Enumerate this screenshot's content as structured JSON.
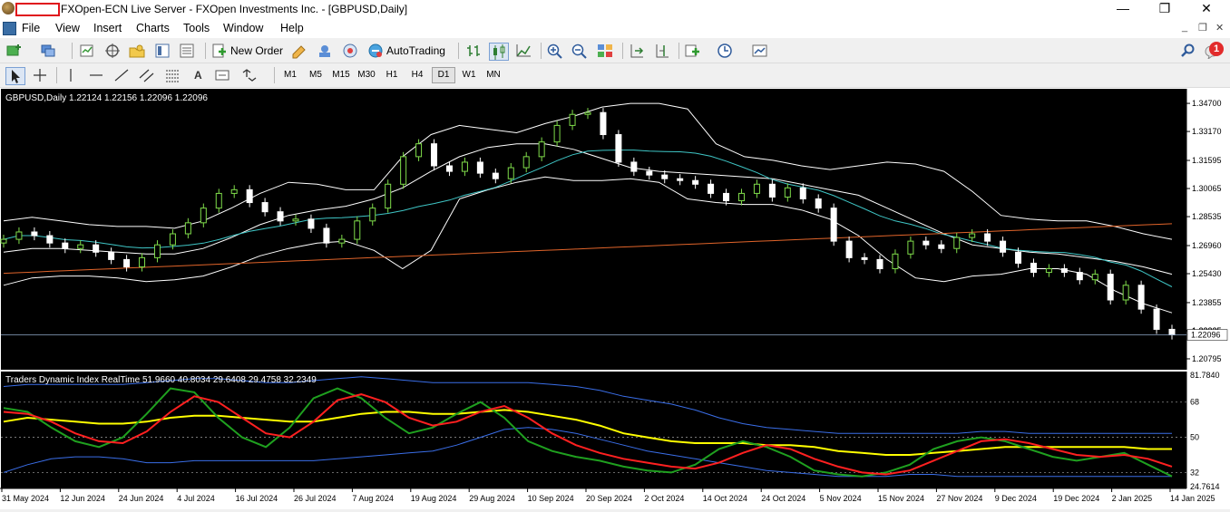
{
  "window": {
    "title": "FXOpen-ECN Live Server - FXOpen Investments Inc. - [GBPUSD,Daily]",
    "minimize_glyph": "—",
    "maximize_glyph": "❐",
    "close_glyph": "✕"
  },
  "menu": {
    "items": [
      "File",
      "View",
      "Insert",
      "Charts",
      "Tools",
      "Window",
      "Help"
    ],
    "mdi_buttons": [
      "_",
      "❐",
      "✕"
    ]
  },
  "toolbar": {
    "new_order_label": "New Order",
    "autotrading_label": "AutoTrading",
    "notification_count": "1",
    "timeframes": [
      "M1",
      "M5",
      "M15",
      "M30",
      "H1",
      "H4",
      "D1",
      "W1",
      "MN"
    ],
    "active_timeframe": "D1",
    "text_tool_label": "A"
  },
  "chart_data": [
    {
      "type": "candlestick",
      "title": "GBPUSD,Daily  1.22124 1.22156 1.22096 1.22096",
      "symbol": "GBPUSD",
      "timeframe": "Daily",
      "ohlc_last": [
        1.22124,
        1.22156,
        1.22096,
        1.22096
      ],
      "current_price_label": "1.22096",
      "current_price_label_behind": "1.22325",
      "y_ticks": [
        "1.34700",
        "1.33170",
        "1.31595",
        "1.30065",
        "1.28535",
        "1.26960",
        "1.25430",
        "1.23855",
        "1.22325",
        "1.20795"
      ],
      "ylim": [
        1.2035,
        1.3495
      ],
      "background_color": "#000000",
      "bull_color": "#7fdc4a",
      "bear_color": "#ffffff",
      "overlays": [
        "Bollinger upper",
        "Bollinger middle",
        "Bollinger lower",
        "Moving average (cyan)",
        "Moving average (orange)"
      ],
      "series": [
        {
          "name": "close",
          "values": [
            1.273,
            1.277,
            1.275,
            1.271,
            1.268,
            1.27,
            1.266,
            1.262,
            1.258,
            1.263,
            1.27,
            1.276,
            1.282,
            1.29,
            1.298,
            1.3,
            1.293,
            1.288,
            1.283,
            1.284,
            1.279,
            1.271,
            1.273,
            1.283,
            1.29,
            1.303,
            1.318,
            1.325,
            1.313,
            1.31,
            1.315,
            1.309,
            1.306,
            1.312,
            1.318,
            1.326,
            1.335,
            1.341,
            1.342,
            1.33,
            1.315,
            1.31,
            1.308,
            1.306,
            1.305,
            1.303,
            1.298,
            1.294,
            1.298,
            1.303,
            1.296,
            1.301,
            1.295,
            1.29,
            1.272,
            1.263,
            1.262,
            1.257,
            1.265,
            1.272,
            1.27,
            1.268,
            1.274,
            1.276,
            1.272,
            1.266,
            1.26,
            1.255,
            1.257,
            1.255,
            1.251,
            1.254,
            1.24,
            1.248,
            1.235,
            1.224,
            1.221
          ]
        },
        {
          "name": "Bollinger upper",
          "values": [
            1.283,
            1.285,
            1.283,
            1.281,
            1.28,
            1.28,
            1.279,
            1.283,
            1.29,
            1.298,
            1.304,
            1.303,
            1.3,
            1.3,
            1.318,
            1.33,
            1.335,
            1.333,
            1.331,
            1.336,
            1.34,
            1.345,
            1.347,
            1.347,
            1.344,
            1.325,
            1.318,
            1.316,
            1.313,
            1.311,
            1.313,
            1.315,
            1.314,
            1.31,
            1.299,
            1.286,
            1.284,
            1.283,
            1.283,
            1.28,
            1.276,
            1.273
          ]
        },
        {
          "name": "Bollinger middle",
          "values": [
            1.266,
            1.268,
            1.268,
            1.267,
            1.266,
            1.265,
            1.265,
            1.268,
            1.274,
            1.281,
            1.286,
            1.289,
            1.291,
            1.295,
            1.301,
            1.31,
            1.318,
            1.323,
            1.325,
            1.325,
            1.322,
            1.317,
            1.312,
            1.31,
            1.309,
            1.308,
            1.307,
            1.306,
            1.303,
            1.3,
            1.297,
            1.29,
            1.283,
            1.276,
            1.27,
            1.268,
            1.266,
            1.265,
            1.263,
            1.261,
            1.258,
            1.254
          ]
        },
        {
          "name": "Bollinger lower",
          "values": [
            1.248,
            1.252,
            1.253,
            1.253,
            1.252,
            1.25,
            1.251,
            1.253,
            1.258,
            1.264,
            1.268,
            1.271,
            1.272,
            1.267,
            1.257,
            1.267,
            1.295,
            1.3,
            1.304,
            1.307,
            1.305,
            1.305,
            1.306,
            1.304,
            1.295,
            1.293,
            1.292,
            1.292,
            1.289,
            1.284,
            1.275,
            1.262,
            1.252,
            1.25,
            1.253,
            1.254,
            1.257,
            1.257,
            1.254,
            1.245,
            1.238,
            1.233
          ]
        }
      ]
    },
    {
      "type": "line",
      "title": "Traders Dynamic Index RealTime 51.9660 40.8034 29.6408 29.4758 32.2349",
      "values_shown": [
        51.966,
        40.8034,
        29.6408,
        29.4758,
        32.2349
      ],
      "y_ticks": [
        "81.7840",
        "68",
        "50",
        "32",
        "24.7614"
      ],
      "ylim": [
        24.7614,
        81.784
      ],
      "levels": [
        68,
        50,
        32
      ],
      "background_color": "#000000",
      "series": [
        {
          "name": "green",
          "color": "#1fa01f",
          "values": [
            65,
            63,
            55,
            48,
            45,
            50,
            62,
            75,
            73,
            60,
            50,
            45,
            55,
            70,
            75,
            70,
            60,
            52,
            55,
            62,
            68,
            60,
            48,
            43,
            40,
            38,
            35,
            33,
            32,
            36,
            44,
            48,
            45,
            40,
            33,
            31,
            30,
            32,
            36,
            44,
            48,
            50,
            48,
            44,
            40,
            38,
            40,
            42,
            36,
            30
          ]
        },
        {
          "name": "red",
          "color": "#ff2020",
          "values": [
            63,
            62,
            58,
            52,
            48,
            47,
            53,
            63,
            71,
            68,
            60,
            52,
            50,
            58,
            69,
            72,
            68,
            60,
            56,
            58,
            63,
            66,
            60,
            52,
            46,
            42,
            39,
            37,
            35,
            34,
            37,
            42,
            46,
            44,
            39,
            35,
            32,
            31,
            33,
            38,
            43,
            48,
            49,
            47,
            44,
            41,
            40,
            41,
            39,
            35
          ]
        },
        {
          "name": "yellow",
          "color": "#ffff00",
          "values": [
            58,
            60,
            59,
            58,
            57,
            57,
            58,
            60,
            61,
            61,
            60,
            59,
            58,
            58,
            60,
            62,
            63,
            63,
            62,
            62,
            63,
            64,
            63,
            61,
            59,
            56,
            52,
            50,
            48,
            47,
            47,
            47,
            46,
            46,
            45,
            43,
            42,
            41,
            41,
            42,
            43,
            44,
            45,
            45,
            45,
            45,
            45,
            45,
            44,
            44
          ]
        },
        {
          "name": "band upper",
          "color": "#3a6ee8",
          "values": [
            76,
            77,
            77,
            77,
            77,
            77,
            78,
            79,
            80,
            80,
            79,
            78,
            78,
            79,
            80,
            81,
            80,
            79,
            78,
            78,
            78,
            78,
            78,
            77,
            76,
            74,
            71,
            69,
            67,
            64,
            60,
            57,
            55,
            54,
            53,
            52,
            52,
            52,
            52,
            52,
            52,
            53,
            53,
            52,
            52,
            52,
            52,
            52,
            52,
            52
          ]
        },
        {
          "name": "band lower",
          "color": "#3a6ee8",
          "values": [
            32,
            36,
            39,
            40,
            40,
            39,
            37,
            37,
            38,
            38,
            38,
            38,
            38,
            38,
            39,
            40,
            41,
            42,
            43,
            46,
            50,
            54,
            55,
            54,
            52,
            49,
            46,
            43,
            41,
            39,
            37,
            35,
            33,
            32,
            31,
            30,
            30,
            30,
            31,
            31,
            30,
            30,
            30,
            30,
            30,
            30,
            30,
            30,
            30,
            30
          ]
        }
      ]
    }
  ],
  "x_ticks": [
    "31 May 2024",
    "12 Jun 2024",
    "24 Jun 2024",
    "4 Jul 2024",
    "16 Jul 2024",
    "26 Jul 2024",
    "7 Aug 2024",
    "19 Aug 2024",
    "29 Aug 2024",
    "10 Sep 2024",
    "20 Sep 2024",
    "2 Oct 2024",
    "14 Oct 2024",
    "24 Oct 2024",
    "5 Nov 2024",
    "15 Nov 2024",
    "27 Nov 2024",
    "9 Dec 2024",
    "19 Dec 2024",
    "2 Jan 2025",
    "14 Jan 2025"
  ]
}
